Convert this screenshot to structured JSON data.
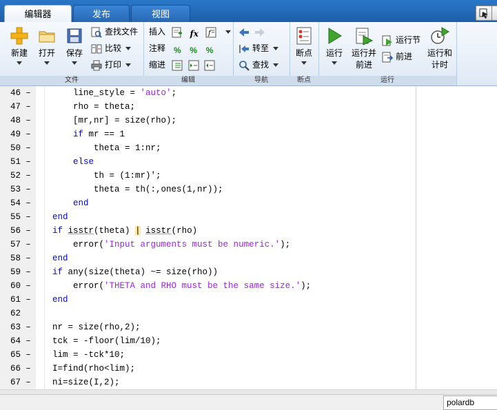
{
  "tabs": [
    {
      "label": "编辑器",
      "active": true
    },
    {
      "label": "发布",
      "active": false
    },
    {
      "label": "视图",
      "active": false
    }
  ],
  "groups": {
    "file": "文件",
    "edit": "编辑",
    "nav": "导航",
    "breakpoint": "断点",
    "run": "运行"
  },
  "file_buttons": {
    "new": "新建",
    "open": "打开",
    "save": "保存",
    "find_files": "查找文件",
    "compare": "比较",
    "print": "打印"
  },
  "edit_buttons": {
    "insert": "插入",
    "comment": "注释",
    "indent": "缩进",
    "fx": "fx"
  },
  "nav_buttons": {
    "goto": "转至",
    "find": "查找"
  },
  "breakpoint_buttons": {
    "breakpoints": "断点"
  },
  "run_buttons": {
    "run": "运行",
    "run_advance_1": "运行并",
    "run_advance_2": "前进",
    "run_section": "运行节",
    "advance": "前进",
    "run_time_1": "运行和",
    "run_time_2": "计时"
  },
  "code": [
    {
      "n": "46",
      "indent": "    ",
      "parts": [
        [
          "t",
          "line_style = "
        ],
        [
          "s",
          "'auto'"
        ],
        [
          "t",
          ";"
        ]
      ]
    },
    {
      "n": "47",
      "indent": "    ",
      "parts": [
        [
          "t",
          "rho = theta;"
        ]
      ]
    },
    {
      "n": "48",
      "indent": "    ",
      "parts": [
        [
          "t",
          "[mr,nr] = size(rho);"
        ]
      ]
    },
    {
      "n": "49",
      "indent": "    ",
      "parts": [
        [
          "k",
          "if"
        ],
        [
          "t",
          " mr == 1"
        ]
      ]
    },
    {
      "n": "50",
      "indent": "        ",
      "parts": [
        [
          "t",
          "theta = 1:nr;"
        ]
      ]
    },
    {
      "n": "51",
      "indent": "    ",
      "parts": [
        [
          "k",
          "else"
        ]
      ]
    },
    {
      "n": "52",
      "indent": "        ",
      "parts": [
        [
          "t",
          "th = (1:mr)';"
        ]
      ]
    },
    {
      "n": "53",
      "indent": "        ",
      "parts": [
        [
          "t",
          "theta = th(:,ones(1,nr));"
        ]
      ]
    },
    {
      "n": "54",
      "indent": "    ",
      "parts": [
        [
          "k",
          "end"
        ]
      ]
    },
    {
      "n": "55",
      "indent": "",
      "parts": [
        [
          "k",
          "end"
        ]
      ]
    },
    {
      "n": "56",
      "indent": "",
      "parts": [
        [
          "k",
          "if"
        ],
        [
          "t",
          " "
        ],
        [
          "u",
          "isstr"
        ],
        [
          "t",
          "(theta) "
        ],
        [
          "h",
          "|"
        ],
        [
          "t",
          " "
        ],
        [
          "u",
          "isstr"
        ],
        [
          "t",
          "(rho)"
        ]
      ]
    },
    {
      "n": "57",
      "indent": "    ",
      "parts": [
        [
          "t",
          "error("
        ],
        [
          "s",
          "'Input arguments must be numeric.'"
        ],
        [
          "t",
          ");"
        ]
      ]
    },
    {
      "n": "58",
      "indent": "",
      "parts": [
        [
          "k",
          "end"
        ]
      ]
    },
    {
      "n": "59",
      "indent": "",
      "parts": [
        [
          "k",
          "if"
        ],
        [
          "t",
          " any(size(theta) ~= size(rho))"
        ]
      ]
    },
    {
      "n": "60",
      "indent": "    ",
      "parts": [
        [
          "t",
          "error("
        ],
        [
          "s",
          "'THETA and RHO must be the same size.'"
        ],
        [
          "t",
          ");"
        ]
      ]
    },
    {
      "n": "61",
      "indent": "",
      "parts": [
        [
          "k",
          "end"
        ]
      ]
    },
    {
      "n": "62",
      "indent": "",
      "parts": []
    },
    {
      "n": "63",
      "indent": "",
      "parts": [
        [
          "t",
          "nr = size(rho,2);"
        ]
      ]
    },
    {
      "n": "64",
      "indent": "",
      "parts": [
        [
          "t",
          "tck = -floor(lim/10);"
        ]
      ]
    },
    {
      "n": "65",
      "indent": "",
      "parts": [
        [
          "t",
          "lim = -tck*10;"
        ]
      ]
    },
    {
      "n": "66",
      "indent": "",
      "parts": [
        [
          "t",
          "I=find(rho<lim);"
        ]
      ]
    },
    {
      "n": "67",
      "indent": "",
      "parts": [
        [
          "t",
          "ni=size(I,2);"
        ]
      ]
    }
  ],
  "status": {
    "filename": "polardb"
  }
}
